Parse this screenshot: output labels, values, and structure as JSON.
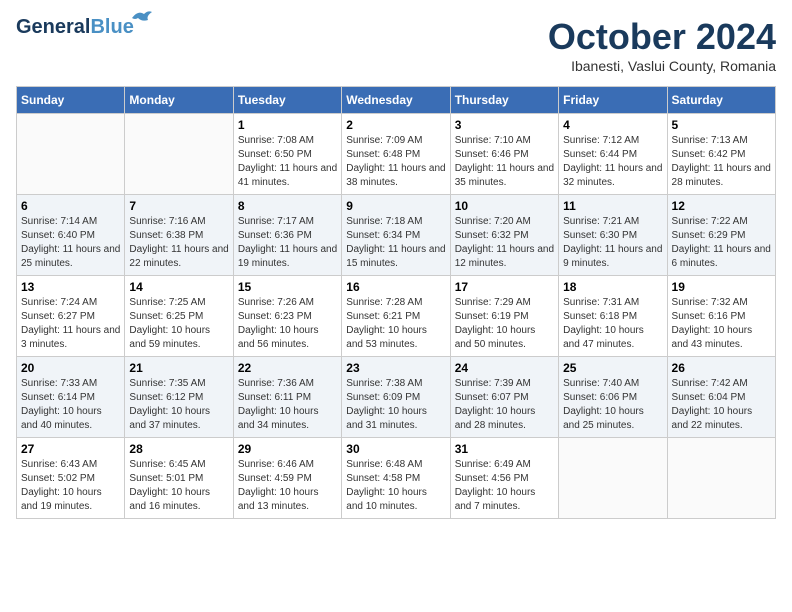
{
  "header": {
    "logo_general": "General",
    "logo_blue": "Blue",
    "month_title": "October 2024",
    "location": "Ibanesti, Vaslui County, Romania"
  },
  "weekdays": [
    "Sunday",
    "Monday",
    "Tuesday",
    "Wednesday",
    "Thursday",
    "Friday",
    "Saturday"
  ],
  "weeks": [
    [
      {
        "day": "",
        "info": ""
      },
      {
        "day": "",
        "info": ""
      },
      {
        "day": "1",
        "info": "Sunrise: 7:08 AM\nSunset: 6:50 PM\nDaylight: 11 hours and 41 minutes."
      },
      {
        "day": "2",
        "info": "Sunrise: 7:09 AM\nSunset: 6:48 PM\nDaylight: 11 hours and 38 minutes."
      },
      {
        "day": "3",
        "info": "Sunrise: 7:10 AM\nSunset: 6:46 PM\nDaylight: 11 hours and 35 minutes."
      },
      {
        "day": "4",
        "info": "Sunrise: 7:12 AM\nSunset: 6:44 PM\nDaylight: 11 hours and 32 minutes."
      },
      {
        "day": "5",
        "info": "Sunrise: 7:13 AM\nSunset: 6:42 PM\nDaylight: 11 hours and 28 minutes."
      }
    ],
    [
      {
        "day": "6",
        "info": "Sunrise: 7:14 AM\nSunset: 6:40 PM\nDaylight: 11 hours and 25 minutes."
      },
      {
        "day": "7",
        "info": "Sunrise: 7:16 AM\nSunset: 6:38 PM\nDaylight: 11 hours and 22 minutes."
      },
      {
        "day": "8",
        "info": "Sunrise: 7:17 AM\nSunset: 6:36 PM\nDaylight: 11 hours and 19 minutes."
      },
      {
        "day": "9",
        "info": "Sunrise: 7:18 AM\nSunset: 6:34 PM\nDaylight: 11 hours and 15 minutes."
      },
      {
        "day": "10",
        "info": "Sunrise: 7:20 AM\nSunset: 6:32 PM\nDaylight: 11 hours and 12 minutes."
      },
      {
        "day": "11",
        "info": "Sunrise: 7:21 AM\nSunset: 6:30 PM\nDaylight: 11 hours and 9 minutes."
      },
      {
        "day": "12",
        "info": "Sunrise: 7:22 AM\nSunset: 6:29 PM\nDaylight: 11 hours and 6 minutes."
      }
    ],
    [
      {
        "day": "13",
        "info": "Sunrise: 7:24 AM\nSunset: 6:27 PM\nDaylight: 11 hours and 3 minutes."
      },
      {
        "day": "14",
        "info": "Sunrise: 7:25 AM\nSunset: 6:25 PM\nDaylight: 10 hours and 59 minutes."
      },
      {
        "day": "15",
        "info": "Sunrise: 7:26 AM\nSunset: 6:23 PM\nDaylight: 10 hours and 56 minutes."
      },
      {
        "day": "16",
        "info": "Sunrise: 7:28 AM\nSunset: 6:21 PM\nDaylight: 10 hours and 53 minutes."
      },
      {
        "day": "17",
        "info": "Sunrise: 7:29 AM\nSunset: 6:19 PM\nDaylight: 10 hours and 50 minutes."
      },
      {
        "day": "18",
        "info": "Sunrise: 7:31 AM\nSunset: 6:18 PM\nDaylight: 10 hours and 47 minutes."
      },
      {
        "day": "19",
        "info": "Sunrise: 7:32 AM\nSunset: 6:16 PM\nDaylight: 10 hours and 43 minutes."
      }
    ],
    [
      {
        "day": "20",
        "info": "Sunrise: 7:33 AM\nSunset: 6:14 PM\nDaylight: 10 hours and 40 minutes."
      },
      {
        "day": "21",
        "info": "Sunrise: 7:35 AM\nSunset: 6:12 PM\nDaylight: 10 hours and 37 minutes."
      },
      {
        "day": "22",
        "info": "Sunrise: 7:36 AM\nSunset: 6:11 PM\nDaylight: 10 hours and 34 minutes."
      },
      {
        "day": "23",
        "info": "Sunrise: 7:38 AM\nSunset: 6:09 PM\nDaylight: 10 hours and 31 minutes."
      },
      {
        "day": "24",
        "info": "Sunrise: 7:39 AM\nSunset: 6:07 PM\nDaylight: 10 hours and 28 minutes."
      },
      {
        "day": "25",
        "info": "Sunrise: 7:40 AM\nSunset: 6:06 PM\nDaylight: 10 hours and 25 minutes."
      },
      {
        "day": "26",
        "info": "Sunrise: 7:42 AM\nSunset: 6:04 PM\nDaylight: 10 hours and 22 minutes."
      }
    ],
    [
      {
        "day": "27",
        "info": "Sunrise: 6:43 AM\nSunset: 5:02 PM\nDaylight: 10 hours and 19 minutes."
      },
      {
        "day": "28",
        "info": "Sunrise: 6:45 AM\nSunset: 5:01 PM\nDaylight: 10 hours and 16 minutes."
      },
      {
        "day": "29",
        "info": "Sunrise: 6:46 AM\nSunset: 4:59 PM\nDaylight: 10 hours and 13 minutes."
      },
      {
        "day": "30",
        "info": "Sunrise: 6:48 AM\nSunset: 4:58 PM\nDaylight: 10 hours and 10 minutes."
      },
      {
        "day": "31",
        "info": "Sunrise: 6:49 AM\nSunset: 4:56 PM\nDaylight: 10 hours and 7 minutes."
      },
      {
        "day": "",
        "info": ""
      },
      {
        "day": "",
        "info": ""
      }
    ]
  ]
}
